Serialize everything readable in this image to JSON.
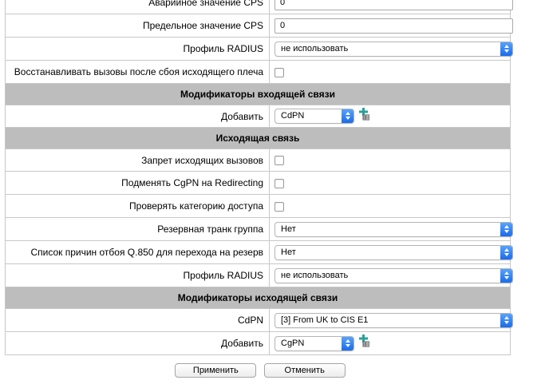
{
  "top_rows": [
    {
      "label": "Аварийное значение CPS",
      "value": "0"
    },
    {
      "label": "Предельное значение CPS",
      "value": "0"
    }
  ],
  "radius_profile_1": {
    "label": "Профиль RADIUS",
    "value": "не использовать"
  },
  "restore_calls": {
    "label": "Восстанавливать вызовы после сбоя исходящего плеча",
    "checked": false
  },
  "incoming_modifiers": {
    "header": "Модификаторы входящей связи",
    "add_label": "Добавить",
    "add_value": "CdPN"
  },
  "outgoing": {
    "header": "Исходящая связь",
    "bar_outgoing": {
      "label": "Запрет исходящих вызовов",
      "checked": false
    },
    "replace_cgpn": {
      "label": "Подменять CgPN на Redirecting",
      "checked": false
    },
    "check_category": {
      "label": "Проверять категорию доступа",
      "checked": false
    },
    "backup_trunk": {
      "label": "Резервная транк группа",
      "value": "Нет"
    },
    "q850_causes": {
      "label": "Список причин отбоя Q.850 для перехода на резерв",
      "value": "Нет"
    },
    "radius_profile": {
      "label": "Профиль RADIUS",
      "value": "не использовать"
    }
  },
  "outgoing_modifiers": {
    "header": "Модификаторы исходящей связи",
    "cdpn_label": "CdPN",
    "cdpn_value": "[3] From UK to CIS E1",
    "add_label": "Добавить",
    "add_value": "CgPN"
  },
  "buttons": {
    "apply": "Применить",
    "cancel": "Отменить"
  },
  "colors": {
    "header_bg": "#bdbdbd",
    "select_arrow": "#1768e8",
    "add_icon": "#2aa198"
  }
}
